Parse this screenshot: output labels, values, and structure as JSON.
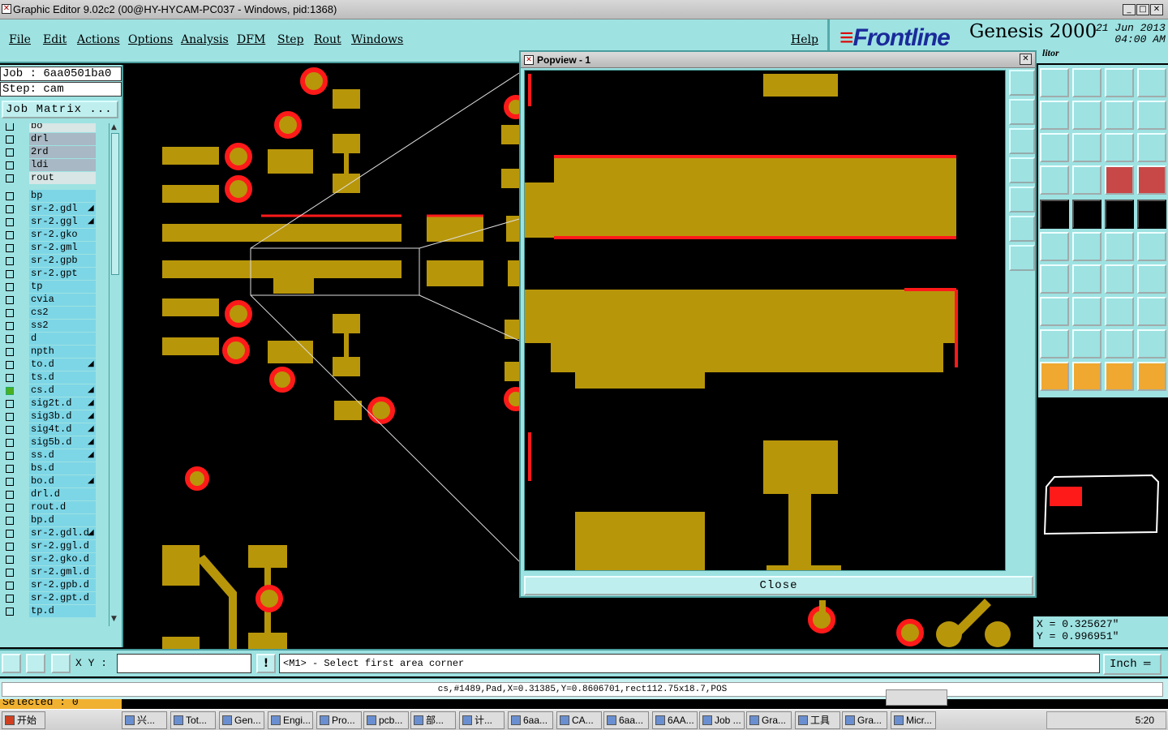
{
  "window": {
    "title": "Graphic Editor 9.02c2 (00@HY-HYCAM-PC037 - Windows, pid:1368)",
    "min": "_",
    "max": "□",
    "close": "✕"
  },
  "menu": {
    "items": [
      "File",
      "Edit",
      "Actions",
      "Options",
      "Analysis",
      "DFM",
      "Step",
      "Rout",
      "Windows"
    ],
    "help": "Help"
  },
  "logo": {
    "brand": "Frontline",
    "product": "Genesis 2000",
    "date_line1": "21 Jun 2013",
    "date_line2": "04:00 AM",
    "caption": "litor"
  },
  "left_panel": {
    "job": "Job  : 6aa0501ba0",
    "step": "Step: cam",
    "job_matrix": "Job Matrix ...",
    "layers": [
      {
        "name": "bo",
        "style": "light",
        "mark": ""
      },
      {
        "name": "drl",
        "style": "gray",
        "mark": ""
      },
      {
        "name": "2rd",
        "style": "gray",
        "mark": ""
      },
      {
        "name": "ldi",
        "style": "gray",
        "mark": ""
      },
      {
        "name": "rout",
        "style": "light",
        "mark": ""
      },
      {
        "name": "bp",
        "style": "cy",
        "mark": ""
      },
      {
        "name": "sr-2.gdl",
        "style": "cy",
        "mark": "◢"
      },
      {
        "name": "sr-2.ggl",
        "style": "cy",
        "mark": "◢"
      },
      {
        "name": "sr-2.gko",
        "style": "cy",
        "mark": ""
      },
      {
        "name": "sr-2.gml",
        "style": "cy",
        "mark": ""
      },
      {
        "name": "sr-2.gpb",
        "style": "cy",
        "mark": ""
      },
      {
        "name": "sr-2.gpt",
        "style": "cy",
        "mark": ""
      },
      {
        "name": "tp",
        "style": "cy",
        "mark": ""
      },
      {
        "name": "cvia",
        "style": "cy",
        "mark": ""
      },
      {
        "name": "cs2",
        "style": "cy",
        "mark": ""
      },
      {
        "name": "ss2",
        "style": "cy",
        "mark": ""
      },
      {
        "name": "d",
        "style": "cy",
        "mark": ""
      },
      {
        "name": "npth",
        "style": "cy",
        "mark": ""
      },
      {
        "name": "to.d",
        "style": "cy",
        "mark": "◢"
      },
      {
        "name": "ts.d",
        "style": "cy",
        "mark": ""
      },
      {
        "name": "cs.d",
        "style": "cy",
        "mark": "◢",
        "active": true
      },
      {
        "name": "sig2t.d",
        "style": "cy",
        "mark": "◢"
      },
      {
        "name": "sig3b.d",
        "style": "cy",
        "mark": "◢"
      },
      {
        "name": "sig4t.d",
        "style": "cy",
        "mark": "◢"
      },
      {
        "name": "sig5b.d",
        "style": "cy",
        "mark": "◢"
      },
      {
        "name": "ss.d",
        "style": "cy",
        "mark": "◢"
      },
      {
        "name": "bs.d",
        "style": "cy",
        "mark": ""
      },
      {
        "name": "bo.d",
        "style": "cy",
        "mark": "◢"
      },
      {
        "name": "drl.d",
        "style": "cy",
        "mark": ""
      },
      {
        "name": "rout.d",
        "style": "cy",
        "mark": ""
      },
      {
        "name": "bp.d",
        "style": "cy",
        "mark": ""
      },
      {
        "name": "sr-2.gdl.d",
        "style": "cy",
        "mark": "◢"
      },
      {
        "name": "sr-2.ggl.d",
        "style": "cy",
        "mark": ""
      },
      {
        "name": "sr-2.gko.d",
        "style": "cy",
        "mark": ""
      },
      {
        "name": "sr-2.gml.d",
        "style": "cy",
        "mark": ""
      },
      {
        "name": "sr-2.gpb.d",
        "style": "cy",
        "mark": ""
      },
      {
        "name": "sr-2.gpt.d",
        "style": "cy",
        "mark": ""
      },
      {
        "name": "tp.d",
        "style": "cy",
        "mark": ""
      }
    ],
    "selected": "Selected : 0"
  },
  "popview": {
    "title": "Popview - 1",
    "close_label": "Close"
  },
  "coords": {
    "x": "X = 0.325627\"",
    "y": "Y = 0.996951\""
  },
  "prompt": {
    "xy_label": "X Y :",
    "message": "<M1> - Select first area corner",
    "unit": "Inch",
    "bang": "!"
  },
  "status": "cs,#1489,Pad,X=0.31385,Y=0.8606701,rect112.75x18.7,POS",
  "taskbar": {
    "start": "开始",
    "tasks": [
      "兴...",
      "Tot...",
      "Gen...",
      "Engi...",
      "Pro...",
      "pcb...",
      "部...",
      "计...",
      "6aa...",
      "CA...",
      "6aa...",
      "6AA...",
      "Job ...",
      "Gra...",
      "工具",
      "Gra...",
      "Micr..."
    ],
    "clock": "5:20"
  },
  "colors": {
    "panel": "#9ee2e2",
    "copper": "#b8960a",
    "pad_red": "#ff1a1a",
    "selected_bg": "#f0b030"
  }
}
